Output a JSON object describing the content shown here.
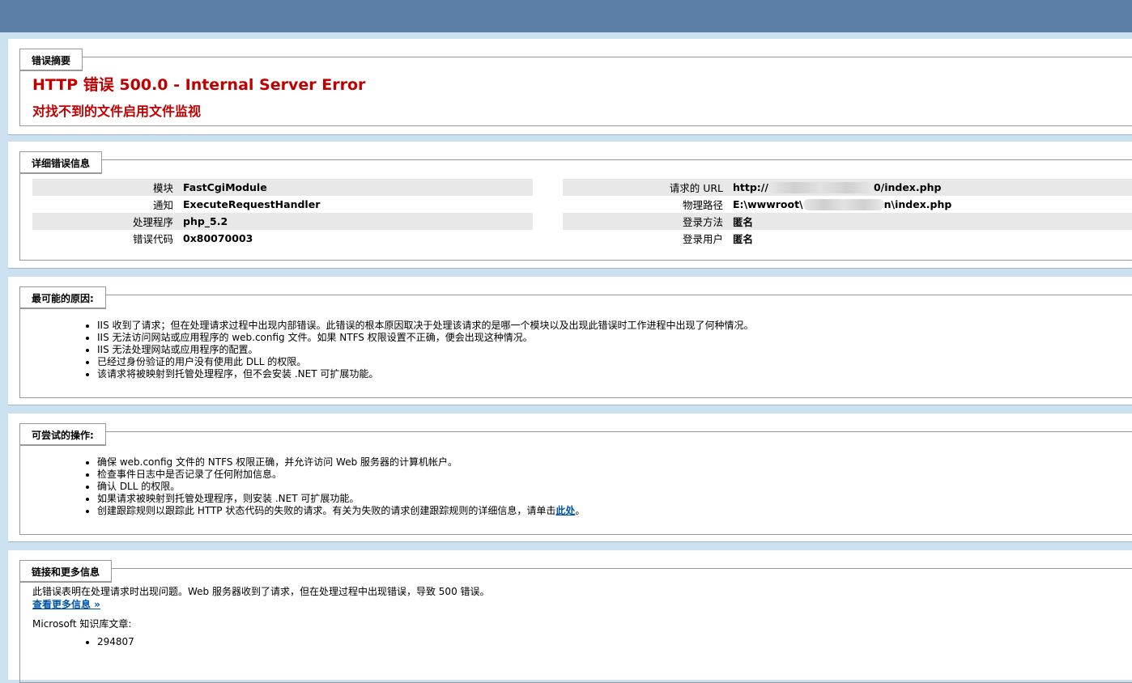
{
  "summary": {
    "legend": "错误摘要",
    "title": "HTTP 错误 500.0 - Internal Server Error",
    "subtitle": "对找不到的文件启用文件监视"
  },
  "details": {
    "legend": "详细错误信息",
    "left": [
      {
        "label": "模块",
        "value": "FastCgiModule"
      },
      {
        "label": "通知",
        "value": "ExecuteRequestHandler"
      },
      {
        "label": "处理程序",
        "value": "php_5.2"
      },
      {
        "label": "错误代码",
        "value": "0x80070003"
      }
    ],
    "right": [
      {
        "label": "请求的 URL",
        "value_prefix": "http://",
        "value_suffix": "0/index.php"
      },
      {
        "label": "物理路径",
        "value_prefix": "E:\\wwwroot\\",
        "value_suffix": "n\\index.php"
      },
      {
        "label": "登录方法",
        "value": "匿名"
      },
      {
        "label": "登录用户",
        "value": "匿名"
      }
    ]
  },
  "causes": {
    "legend": "最可能的原因:",
    "items": [
      "IIS 收到了请求；但在处理请求过程中出现内部错误。此错误的根本原因取决于处理该请求的是哪一个模块以及出现此错误时工作进程中出现了何种情况。",
      "IIS 无法访问网站或应用程序的 web.config 文件。如果 NTFS 权限设置不正确，便会出现这种情况。",
      "IIS 无法处理网站或应用程序的配置。",
      "已经过身份验证的用户没有使用此 DLL 的权限。",
      "该请求将被映射到托管处理程序，但不会安装 .NET 可扩展功能。"
    ]
  },
  "actions": {
    "legend": "可尝试的操作:",
    "items": [
      "确保 web.config 文件的 NTFS 权限正确，并允许访问 Web 服务器的计算机帐户。",
      "检查事件日志中是否记录了任何附加信息。",
      "确认 DLL 的权限。",
      "如果请求被映射到托管处理程序，则安装 .NET 可扩展功能。"
    ],
    "last_item_text": "创建跟踪规则以跟踪此 HTTP 状态代码的失败的请求。有关为失败的请求创建跟踪规则的详细信息，请单击",
    "last_item_link": "此处",
    "last_item_end": "。"
  },
  "links": {
    "legend": "链接和更多信息",
    "description": "此错误表明在处理请求时出现问题。Web 服务器收到了请求，但在处理过程中出现错误，导致 500 错误。",
    "more_link": "查看更多信息 »",
    "kb_label": "Microsoft 知识库文章:",
    "kb_items": [
      "294807"
    ]
  },
  "colors": {
    "topbar": "#5c7fa7",
    "background": "#cbe1ef",
    "error_red": "#c00000",
    "link": "#0054a6"
  }
}
